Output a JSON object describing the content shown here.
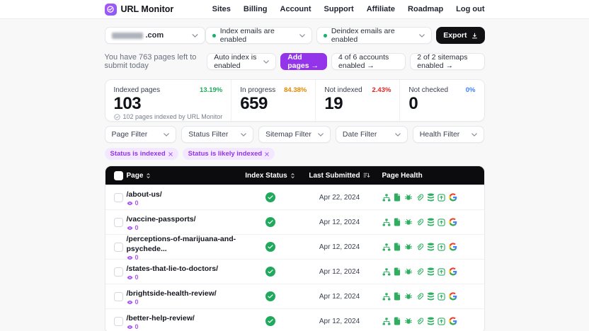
{
  "colors": {
    "accent_purple": "#9333ea",
    "success_green": "#1fa95c",
    "warning_orange": "#e08a00",
    "danger_red": "#dc2626",
    "info_blue": "#3b82f6",
    "header_black": "#0c0c0e"
  },
  "topbar": {
    "brand": "URL Monitor",
    "nav": [
      "Sites",
      "Billing",
      "Account",
      "Support",
      "Affiliate",
      "Roadmap",
      "Log out"
    ]
  },
  "toolbar": {
    "domain_suffix": ".com",
    "index_emails_label": "Index emails are enabled",
    "deindex_emails_label": "Deindex emails are enabled",
    "export_label": "Export"
  },
  "submitbar": {
    "quota_text": "You have 763 pages left to submit today",
    "auto_index_label": "Auto index is enabled",
    "add_pages_label": "Add pages →",
    "accounts_label": "4 of 6 accounts enabled →",
    "sitemaps_label": "2 of 2 sitemaps enabled →"
  },
  "stats": [
    {
      "label": "Indexed pages",
      "pct": "13.19%",
      "value": "103",
      "note": "102 pages indexed by URL Monitor",
      "color": "#1fa95c"
    },
    {
      "label": "In progress",
      "pct": "84.38%",
      "value": "659",
      "note": "",
      "color": "#e08a00"
    },
    {
      "label": "Not indexed",
      "pct": "2.43%",
      "value": "19",
      "note": "",
      "color": "#dc2626"
    },
    {
      "label": "Not checked",
      "pct": "0%",
      "value": "0",
      "note": "",
      "color": "#3b82f6"
    }
  ],
  "filters": [
    "Page Filter",
    "Status Filter",
    "Sitemap Filter",
    "Date Filter",
    "Health Filter"
  ],
  "active_filters": [
    "Status is indexed",
    "Status is likely indexed"
  ],
  "table": {
    "columns": [
      "Page",
      "Index Status",
      "Last Submitted",
      "Page Health"
    ],
    "health_icons": [
      "sitemap-icon",
      "page-file-icon",
      "robot-icon",
      "link-icon",
      "database-icon",
      "submit-icon",
      "google-icon"
    ],
    "rows": [
      {
        "page": "/about-us/",
        "views": "0",
        "status": "indexed",
        "date": "Apr 22, 2024"
      },
      {
        "page": "/vaccine-passports/",
        "views": "0",
        "status": "indexed",
        "date": "Apr 12, 2024"
      },
      {
        "page": "/perceptions-of-marijuana-and-psychede...",
        "views": "0",
        "status": "indexed",
        "date": "Apr 12, 2024"
      },
      {
        "page": "/states-that-lie-to-doctors/",
        "views": "0",
        "status": "indexed",
        "date": "Apr 12, 2024"
      },
      {
        "page": "/brightside-health-review/",
        "views": "0",
        "status": "indexed",
        "date": "Apr 12, 2024"
      },
      {
        "page": "/better-help-review/",
        "views": "0",
        "status": "indexed",
        "date": "Apr 12, 2024"
      }
    ]
  }
}
